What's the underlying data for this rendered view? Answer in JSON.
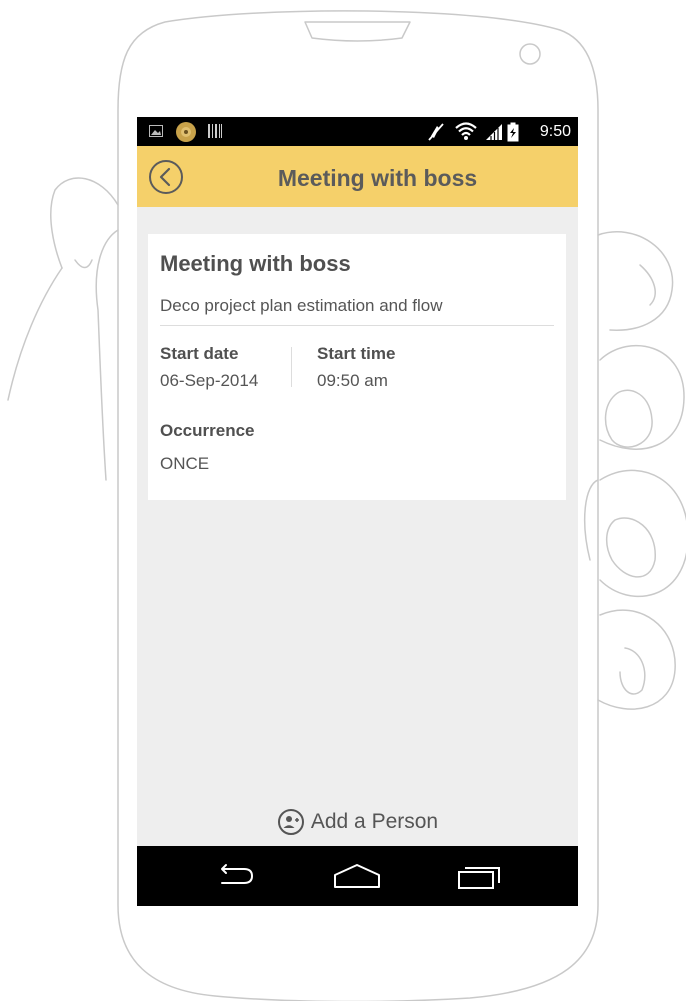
{
  "status_bar": {
    "time": "9:50",
    "icons": [
      "image-notification-icon",
      "music-notification-icon",
      "barcode-notification-icon",
      "mute-icon",
      "wifi-icon",
      "signal-icon",
      "battery-icon"
    ]
  },
  "app_bar": {
    "title": "Meeting with boss",
    "color": "#f5d06a",
    "back_icon": "back-circle-icon"
  },
  "card": {
    "title": "Meeting with boss",
    "description": "Deco project plan estimation and flow",
    "start_date": {
      "label": "Start date",
      "value": "06-Sep-2014"
    },
    "start_time": {
      "label": "Start time",
      "value": "09:50 am"
    },
    "occurrence": {
      "label": "Occurrence",
      "value": "ONCE"
    }
  },
  "add_person": {
    "label": "Add a Person",
    "icon": "add-person-icon"
  },
  "nav_bar": {
    "icons": [
      "back-nav-icon",
      "home-nav-icon",
      "recents-nav-icon"
    ]
  }
}
